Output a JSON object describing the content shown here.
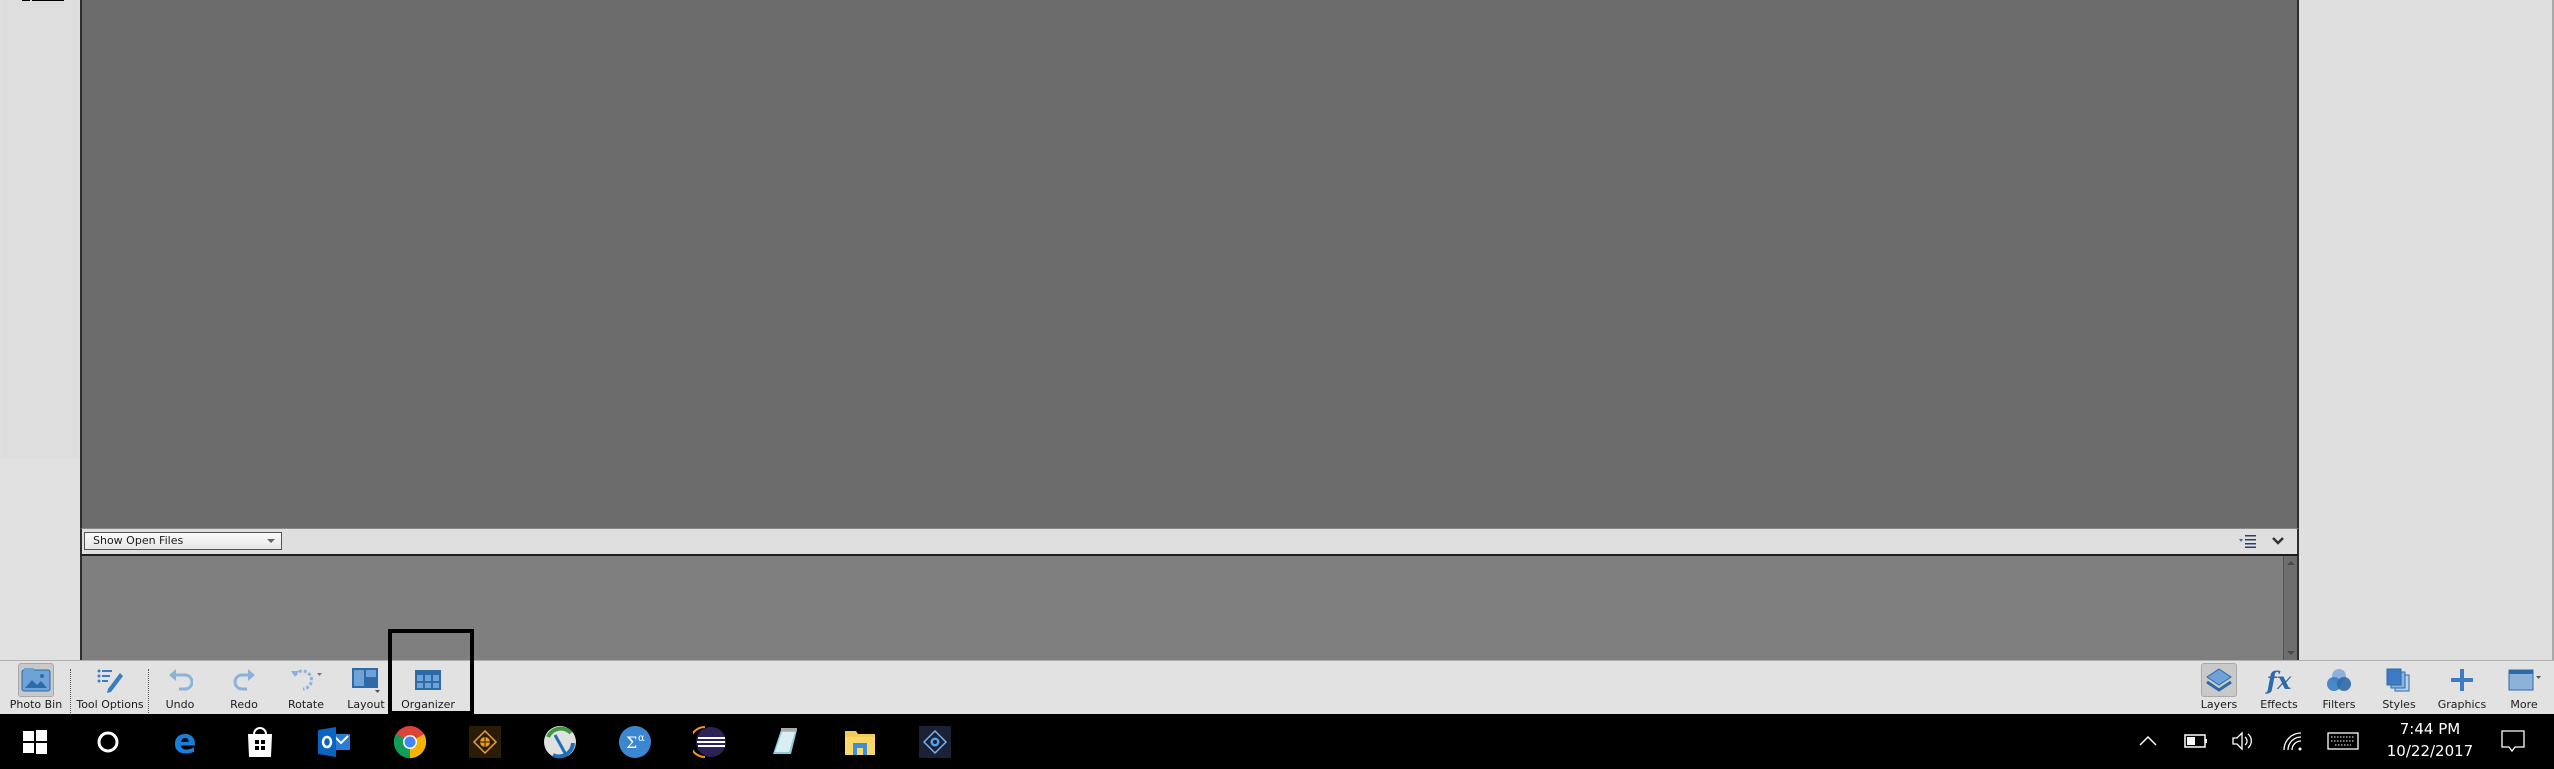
{
  "app": {
    "name": "Photoshop Elements Editor"
  },
  "photo_bin": {
    "select_value": "Show Open Files",
    "menu_icon": "bin-options-icon",
    "collapse_icon": "chevron-down-icon"
  },
  "task_panel": {
    "left": [
      {
        "label": "Photo Bin",
        "icon": "photo-bin-icon",
        "active": true
      },
      {
        "label": "Tool Options",
        "icon": "tool-options-icon",
        "active": false
      },
      {
        "label": "Undo",
        "icon": "undo-icon",
        "active": false
      },
      {
        "label": "Redo",
        "icon": "redo-icon",
        "active": false
      },
      {
        "label": "Rotate",
        "icon": "rotate-icon",
        "active": false
      },
      {
        "label": "Layout",
        "icon": "layout-icon",
        "active": false
      },
      {
        "label": "Organizer",
        "icon": "organizer-icon",
        "active": false,
        "highlighted": true
      }
    ],
    "right": [
      {
        "label": "Layers",
        "icon": "layers-icon",
        "active": true
      },
      {
        "label": "Effects",
        "icon": "fx-icon",
        "active": false
      },
      {
        "label": "Filters",
        "icon": "filters-icon",
        "active": false
      },
      {
        "label": "Styles",
        "icon": "styles-icon",
        "active": false
      },
      {
        "label": "Graphics",
        "icon": "plus-icon",
        "active": false
      },
      {
        "label": "More",
        "icon": "more-panel-icon",
        "active": false
      }
    ]
  },
  "taskbar": {
    "apps": [
      {
        "name": "start",
        "icon": "windows-logo-icon"
      },
      {
        "name": "cortana",
        "icon": "cortana-circle-icon"
      },
      {
        "name": "edge",
        "icon": "edge-icon"
      },
      {
        "name": "store",
        "icon": "store-icon"
      },
      {
        "name": "outlook",
        "icon": "outlook-icon"
      },
      {
        "name": "chrome",
        "icon": "chrome-icon"
      },
      {
        "name": "premiere-elements",
        "icon": "premiere-elements-icon"
      },
      {
        "name": "anyconnect",
        "icon": "anyconnect-icon"
      },
      {
        "name": "math-input",
        "icon": "math-input-icon"
      },
      {
        "name": "eclipse",
        "icon": "eclipse-icon"
      },
      {
        "name": "notepad",
        "icon": "notepad-icon"
      },
      {
        "name": "file-explorer",
        "icon": "folder-icon"
      },
      {
        "name": "photoshop-elements",
        "icon": "photoshop-elements-icon"
      }
    ],
    "tray": [
      "chevron-up-icon",
      "battery-icon",
      "volume-icon",
      "wifi-icon",
      "keyboard-icon"
    ],
    "time": "7:44 PM",
    "date": "10/22/2017",
    "notification_icon": "action-center-icon"
  },
  "colors": {
    "accent_blue": "#3b7cc4",
    "canvas": "#6c6c6c",
    "bin": "#7f7f7f",
    "panel": "#dfdfdf"
  }
}
